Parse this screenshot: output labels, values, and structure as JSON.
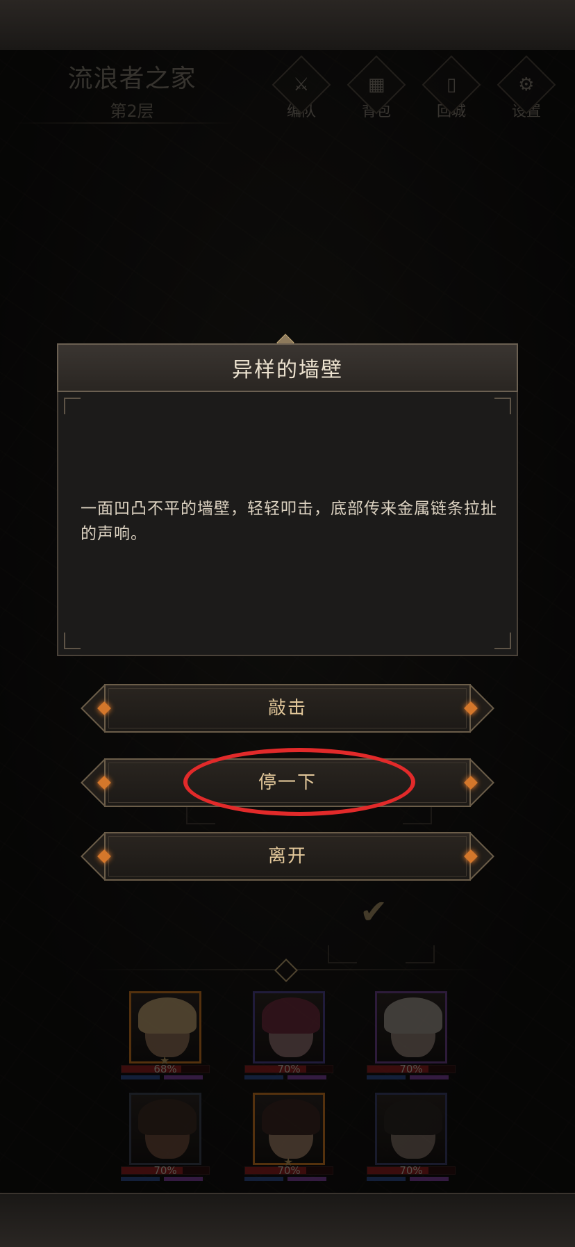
{
  "location": {
    "name": "流浪者之家",
    "floor": "第2层"
  },
  "nav": [
    {
      "label": "编队",
      "icon": "helmet-icon",
      "glyph": "⚔"
    },
    {
      "label": "背包",
      "icon": "backpack-icon",
      "glyph": "▦"
    },
    {
      "label": "回城",
      "icon": "door-icon",
      "glyph": "▯"
    },
    {
      "label": "设置",
      "icon": "gear-icon",
      "glyph": "⚙"
    }
  ],
  "event": {
    "title": "异样的墙壁",
    "description": "一面凹凸不平的墙壁，轻轻叩击，底部传来金属链条拉扯的声响。"
  },
  "choices": [
    {
      "label": "敲击"
    },
    {
      "label": "停一下"
    },
    {
      "label": "离开"
    }
  ],
  "highlight_color": "#e22a2a",
  "accent_color": "#e2c79a",
  "party": [
    {
      "hp_text": "68%",
      "hp": 0.68,
      "frame_color": "#c8731f",
      "hair": "#b49a6a",
      "skin": "#8a6a52",
      "star": true
    },
    {
      "hp_text": "70%",
      "hp": 0.7,
      "frame_color": "#4a3f8a",
      "hair": "#6a2a3a",
      "skin": "#8a6a6a",
      "star": false
    },
    {
      "hp_text": "70%",
      "hp": 0.7,
      "frame_color": "#6a3f8a",
      "hair": "#9a9088",
      "skin": "#8a7a70",
      "star": false
    },
    {
      "hp_text": "70%",
      "hp": 0.7,
      "frame_color": "#3a4050",
      "hair": "#3a2a22",
      "skin": "#6a4a3a",
      "star": false
    },
    {
      "hp_text": "70%",
      "hp": 0.7,
      "frame_color": "#c8731f",
      "hair": "#3a2420",
      "skin": "#9a7a62",
      "star": true
    },
    {
      "hp_text": "70%",
      "hp": 0.7,
      "frame_color": "#3a3f6a",
      "hair": "#2a2420",
      "skin": "#7a6a60",
      "star": false
    }
  ]
}
